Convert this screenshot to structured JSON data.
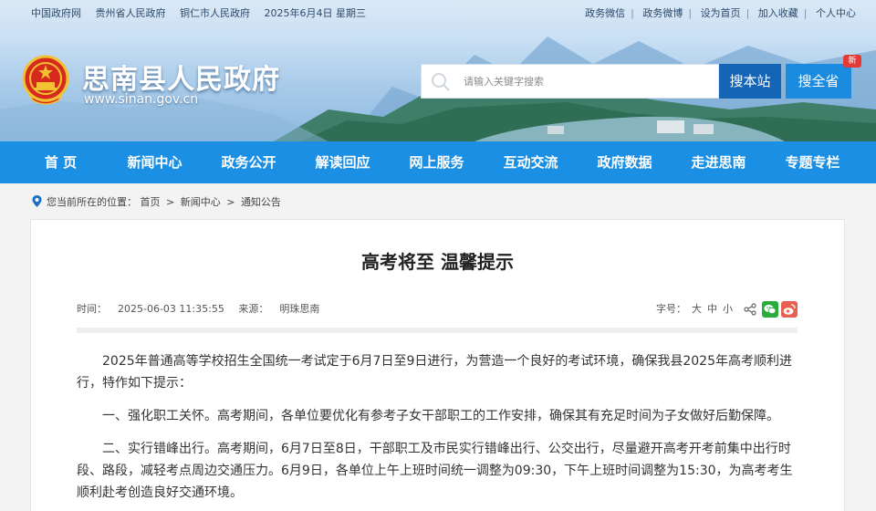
{
  "topbar": {
    "links_left": [
      "中国政府网",
      "贵州省人民政府",
      "铜仁市人民政府",
      "2025年6月4日 星期三"
    ],
    "links_right": [
      "政务微信",
      "政务微博",
      "设为首页",
      "加入收藏",
      "个人中心"
    ]
  },
  "header": {
    "site_title": "思南县人民政府",
    "domain": "www.sinan.gov.cn",
    "search_placeholder": "请输入关键字搜索",
    "search_site_label": "搜本站",
    "search_province_label": "搜全省",
    "badge": "新"
  },
  "nav": {
    "items": [
      "首 页",
      "新闻中心",
      "政务公开",
      "解读回应",
      "网上服务",
      "互动交流",
      "政府数据",
      "走进思南",
      "专题专栏"
    ]
  },
  "breadcrumb": {
    "prefix": "您当前所在的位置：",
    "items": [
      "首页",
      "新闻中心",
      "通知公告"
    ],
    "separator": ">"
  },
  "article": {
    "title": "高考将至 温馨提示",
    "time_label": "时间：",
    "time": "2025-06-03 11:35:55",
    "source_label": "来源：",
    "source": "明珠思南",
    "font_size_label": "字号：",
    "font_sizes": [
      "大",
      "中",
      "小"
    ],
    "paragraphs": [
      "2025年普通高等学校招生全国统一考试定于6月7日至9日进行，为营造一个良好的考试环境，确保我县2025年高考顺利进行，特作如下提示：",
      "一、强化职工关怀。高考期间，各单位要优化有参考子女干部职工的工作安排，确保其有充足时间为子女做好后勤保障。",
      "二、实行错峰出行。高考期间，6月7日至8日，干部职工及市民实行错峰出行、公交出行，尽量避开高考开考前集中出行时段、路段，减轻考点周边交通压力。6月9日，各单位上午上班时间统一调整为09:30，下午上班时间调整为15:30，为高考考生顺利赴考创造良好交通环境。"
    ]
  },
  "colors": {
    "nav_bg": "#1a8fe3",
    "search_site_bg": "#1565b6",
    "search_province_bg": "#1a8bde",
    "badge_bg": "#e53935"
  }
}
